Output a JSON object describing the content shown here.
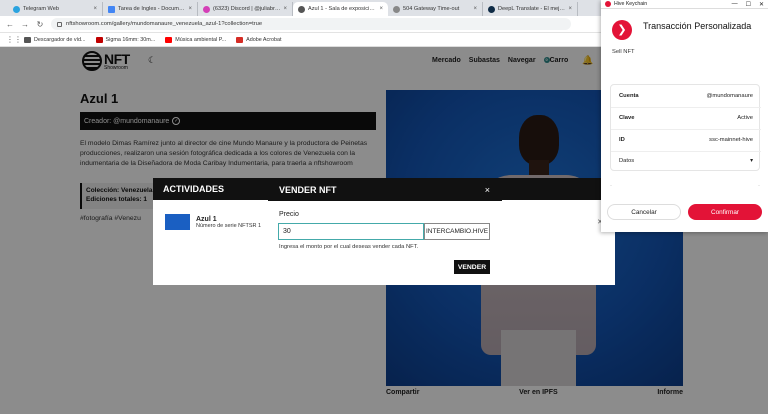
{
  "browser": {
    "tabs": [
      {
        "title": "Telegram Web",
        "color": "#2aa3df"
      },
      {
        "title": "Tarea de Ingles - Documentos de",
        "color": "#4285f4"
      },
      {
        "title": "(6323) Discord | @juliabrouestri",
        "color": "#d43fb7"
      },
      {
        "title": "Azul 1 - Sala de exposición de N",
        "color": "#555555",
        "active": true
      },
      {
        "title": "504 Gateway Time-out",
        "color": "#888888"
      },
      {
        "title": "DeepL Translate - El mejor tradu",
        "color": "#0f2b46"
      }
    ],
    "url": "nftshowroom.com/gallery/mundomanaure_venezuela_azul-1?collection=true",
    "bookmarks": [
      {
        "label": "Descargador de víd...",
        "color": "#555555"
      },
      {
        "label": "Sigma 16mm: 30m...",
        "color": "#c00000"
      },
      {
        "label": "Música ambiental P...",
        "color": "#ff0000"
      },
      {
        "label": "Adobe Acrobat",
        "color": "#d52c25"
      }
    ]
  },
  "site": {
    "logo_main": "NFT",
    "logo_sub": "Showroom",
    "nav": {
      "market": "Mercado",
      "auctions": "Subastas",
      "browse": "Navegar",
      "cart": "Carro",
      "cart_count": "0"
    }
  },
  "nft": {
    "title": "Azul 1",
    "creator": "Creador: @mundomanaure",
    "description": "El modelo Dimas Ramírez junto al director de cine Mundo Manaure y la productora de Peinetas producciones, realizaron una sesión fotográfica dedicada a los colores de Venezuela con la indumentaria de la Diseñadora de Moda Caribay Indumentaria, para traerla a nftshowroom",
    "collection": "Colección: Venezuela",
    "editions": "Ediciones totales: 1",
    "tags": "#fotografía #Venezu",
    "bottom": {
      "share": "Compartir",
      "ipfs": "Ver en IPFS",
      "report": "Informe"
    }
  },
  "activities": {
    "heading": "ACTIVIDADES",
    "item_name": "Azul 1",
    "item_sub": "Número de serie NFTSR 1"
  },
  "sell_modal": {
    "heading": "VENDER NFT",
    "price_label": "Precio",
    "price_value": "30",
    "currency": "INTERCAMBIO.HIVE",
    "hint": "Ingresa el monto por el cual deseas vender cada NFT.",
    "submit": "VENDER"
  },
  "keychain": {
    "window_title": "Hive Keychain",
    "title": "Transacción Personalizada",
    "subtitle": "Sell NFT",
    "rows": [
      {
        "key": "Cuenta",
        "value": "@mundomanaure"
      },
      {
        "key": "Clave",
        "value": "Active"
      },
      {
        "key": "ID",
        "value": "ssc-mainnet-hive"
      },
      {
        "key": "Datos",
        "value": ""
      }
    ],
    "cancel": "Cancelar",
    "confirm": "Confirmar",
    "accent": "#e31337"
  }
}
